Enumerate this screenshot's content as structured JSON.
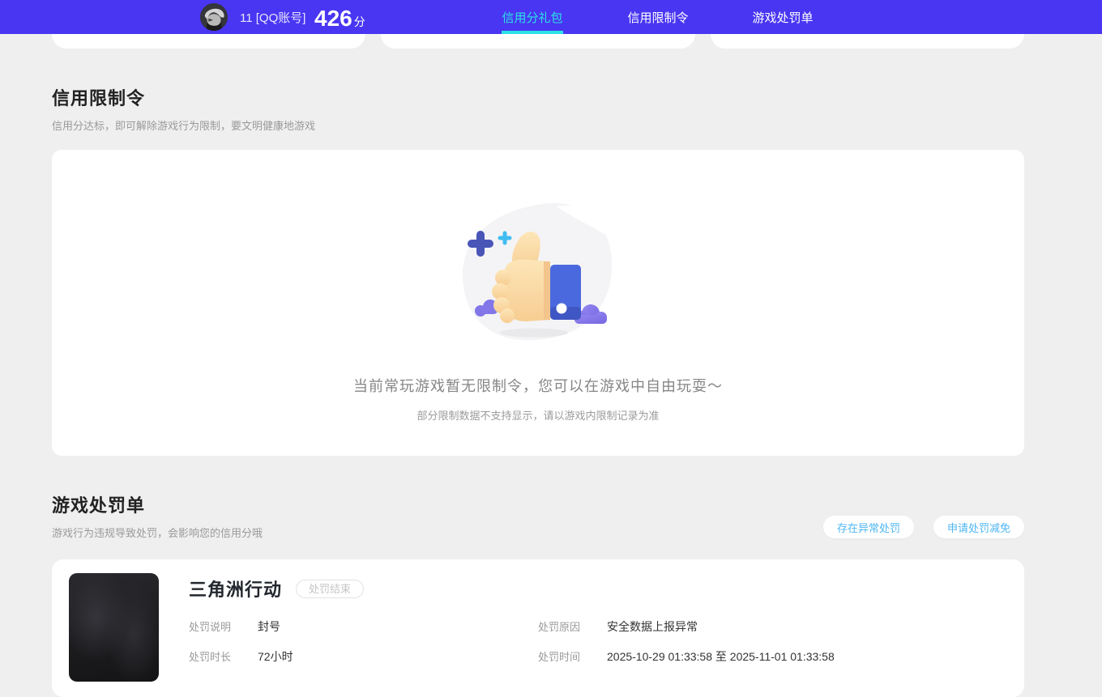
{
  "header": {
    "user": {
      "name": "11 [QQ账号]",
      "score": "426",
      "score_unit": "分"
    },
    "tabs": [
      {
        "label": "信用分礼包",
        "active": true
      },
      {
        "label": "信用限制令",
        "active": false
      },
      {
        "label": "游戏处罚单",
        "active": false
      }
    ]
  },
  "restriction_section": {
    "title": "信用限制令",
    "subtitle": "信用分达标，即可解除游戏行为限制，要文明健康地游戏",
    "empty_state": {
      "message": "当前常玩游戏暂无限制令，您可以在游戏中自由玩耍～",
      "note": "部分限制数据不支持显示，请以游戏内限制记录为准"
    }
  },
  "punishment_section": {
    "title": "游戏处罚单",
    "subtitle": "游戏行为违规导致处罚，会影响您的信用分哦",
    "actions": [
      {
        "label": "存在异常处罚"
      },
      {
        "label": "申请处罚减免"
      }
    ],
    "card": {
      "game_name": "三角洲行动",
      "status_badge": "处罚结束",
      "fields": [
        {
          "label": "处罚说明",
          "value": "封号"
        },
        {
          "label": "处罚原因",
          "value": "安全数据上报异常"
        },
        {
          "label": "处罚时长",
          "value": "72小时"
        },
        {
          "label": "处罚时间",
          "value": "2025-10-29 01:33:58 至 2025-11-01 01:33:58"
        }
      ]
    }
  },
  "colors": {
    "header_bg": "#4936f2",
    "active_tab": "#2be2e5",
    "action_text": "#4eb6f2",
    "page_bg": "#efefef"
  }
}
